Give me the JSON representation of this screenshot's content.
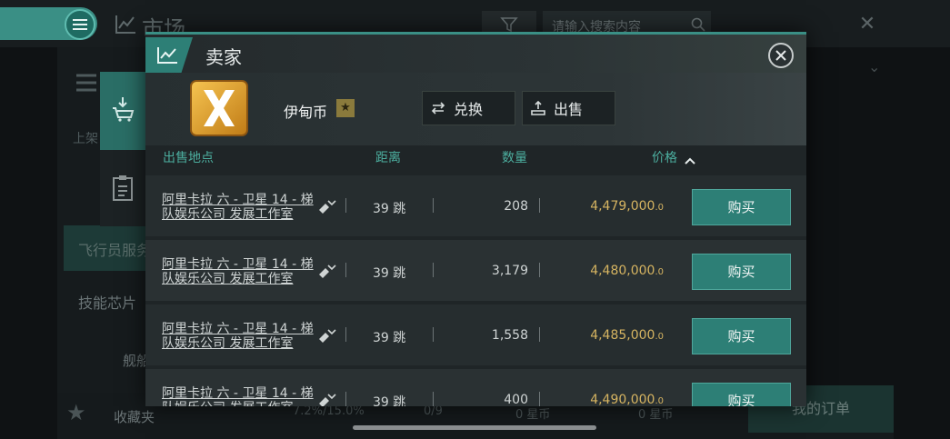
{
  "background": {
    "title": "市场",
    "search_placeholder": "请输入搜索内容",
    "side_label": "上架",
    "sidebar": [
      "飞行员服务",
      "技能芯片",
      "舰船"
    ],
    "favorites": "收藏夹",
    "stats": [
      "7.2%/15.0%",
      "0/9",
      "0 星币",
      "0 星币"
    ],
    "my_orders": "我的订单"
  },
  "modal": {
    "title": "卖家",
    "item": {
      "name": "伊甸币",
      "star": "★"
    },
    "actions": {
      "exchange": "兑换",
      "sell": "出售"
    },
    "columns": {
      "location": "出售地点",
      "distance": "距离",
      "quantity": "数量",
      "price": "价格"
    },
    "rows": [
      {
        "location": "阿里卡拉 六 - 卫星 14 - 梯队娱乐公司 发展工作室",
        "jumps": "39 跳",
        "quantity": "208",
        "price": "4,479,000",
        "price_dec": ".0",
        "buy": "购买"
      },
      {
        "location": "阿里卡拉 六 - 卫星 14 - 梯队娱乐公司 发展工作室",
        "jumps": "39 跳",
        "quantity": "3,179",
        "price": "4,480,000",
        "price_dec": ".0",
        "buy": "购买"
      },
      {
        "location": "阿里卡拉 六 - 卫星 14 - 梯队娱乐公司 发展工作室",
        "jumps": "39 跳",
        "quantity": "1,558",
        "price": "4,485,000",
        "price_dec": ".0",
        "buy": "购买"
      },
      {
        "location": "阿里卡拉 六 - 卫星 14 - 梯队娱乐公司 发展工作室",
        "jumps": "39 跳",
        "quantity": "400",
        "price": "4,490,000",
        "price_dec": ".0",
        "buy": "购买"
      }
    ]
  },
  "colors": {
    "accent": "#2d7f76",
    "price": "#d6b461",
    "header_text": "#4cae9f"
  },
  "icons": [
    "hamburger-icon",
    "chart-icon",
    "filter-icon",
    "search-icon",
    "close-icon",
    "cart-icon",
    "clipboard-icon",
    "route-icon",
    "exchange-icon",
    "sell-icon",
    "star-icon",
    "sort-up-icon"
  ]
}
